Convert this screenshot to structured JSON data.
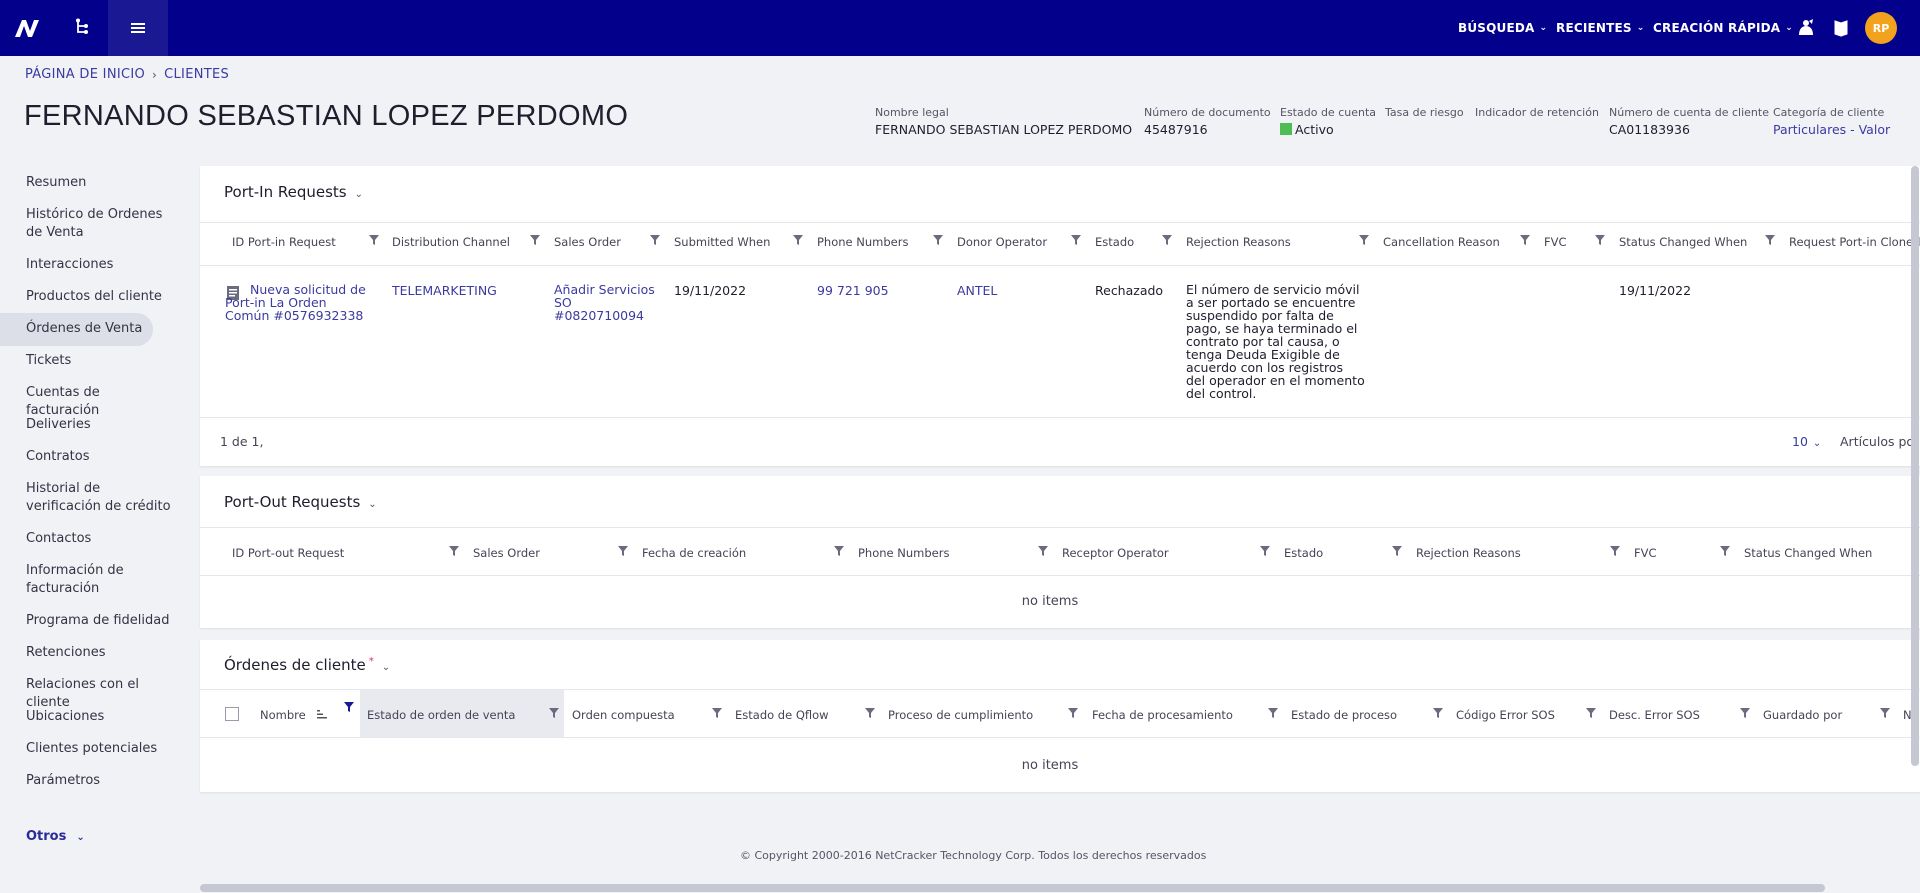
{
  "topbar": {
    "nav": [
      {
        "label": "BÚSQUEDA"
      },
      {
        "label": "RECIENTES"
      },
      {
        "label": "CREACIÓN RÁPIDA"
      }
    ],
    "avatar_initials": "RP",
    "colors": {
      "bar": "#03008c",
      "avatar": "#f2a21d"
    }
  },
  "breadcrumb": {
    "home": "PÁGINA DE INICIO",
    "current": "CLIENTES"
  },
  "page_title": "FERNANDO SEBASTIAN LOPEZ PERDOMO",
  "details": [
    {
      "label": "Nombre legal",
      "value": "FERNANDO SEBASTIAN LOPEZ PERDOMO"
    },
    {
      "label": "Número de documento",
      "value": "45487916"
    },
    {
      "label": "Estado de cuenta",
      "value": "Activo"
    },
    {
      "label": "Tasa de riesgo",
      "value": ""
    },
    {
      "label": "Indicador de retención",
      "value": ""
    },
    {
      "label": "Número de cuenta de cliente",
      "value": "CA01183936"
    },
    {
      "label": "Categoría de cliente",
      "value": "Particulares - Valor"
    }
  ],
  "sidebar": {
    "items": [
      {
        "label": "Resumen"
      },
      {
        "label": "Histórico de Ordenes de Venta"
      },
      {
        "label": "Interacciones"
      },
      {
        "label": "Productos del cliente"
      },
      {
        "label": "Órdenes de Venta",
        "active": true
      },
      {
        "label": "Tickets"
      },
      {
        "label": "Cuentas de facturación"
      },
      {
        "label": "Deliveries"
      },
      {
        "label": "Contratos"
      },
      {
        "label": "Historial de verificación de crédito"
      },
      {
        "label": "Contactos"
      },
      {
        "label": "Información de facturación"
      },
      {
        "label": "Programa de fidelidad"
      },
      {
        "label": "Retenciones"
      },
      {
        "label": "Relaciones con el cliente"
      },
      {
        "label": "Ubicaciones"
      },
      {
        "label": "Clientes potenciales"
      },
      {
        "label": "Parámetros"
      }
    ],
    "otros": "Otros"
  },
  "port_in": {
    "title": "Port-In Requests",
    "columns": [
      "ID Port-in Request",
      "Distribution Channel",
      "Sales Order",
      "Submitted When",
      "Phone Numbers",
      "Donor Operator",
      "Estado",
      "Rejection Reasons",
      "Cancellation Reason",
      "FVC",
      "Status Changed When",
      "Request Port-in Cloned"
    ],
    "row": {
      "id": "Nueva solicitud de Port-in La Orden Común #0576932338",
      "channel": "TELEMARKETING",
      "sales_order": "Añadir Servicios SO #0820710094",
      "submitted": "19/11/2022",
      "phone": "99 721 905",
      "donor": "ANTEL",
      "estado": "Rechazado",
      "rejection": "El número de servicio móvil a ser portado se encuentre suspendido por falta de pago, se haya terminado el contrato por tal causa, o tenga Deuda Exigible de acuerdo con los registros del operador en el momento del control.",
      "status_changed": "19/11/2022"
    },
    "pagination": {
      "summary": "1 de 1,",
      "page_size": "10",
      "per_page_label": "Artículos po"
    }
  },
  "port_out": {
    "title": "Port-Out Requests",
    "columns": [
      "ID Port-out Request",
      "Sales Order",
      "Fecha de creación",
      "Phone Numbers",
      "Receptor Operator",
      "Estado",
      "Rejection Reasons",
      "FVC",
      "Status Changed When"
    ],
    "empty": "no items"
  },
  "orders": {
    "title": "Órdenes de cliente",
    "required_mark": "*",
    "columns": [
      "Nombre",
      "Estado de orden de venta",
      "Orden compuesta",
      "Estado de Qflow",
      "Proceso de cumplimiento",
      "Fecha de procesamiento",
      "Estado de proceso",
      "Código Error SOS",
      "Desc. Error SOS",
      "Guardado por",
      "N"
    ],
    "empty": "no items"
  },
  "copyright": "© Copyright 2000-2016 NetCracker Technology Corp. Todos los derechos reservados"
}
